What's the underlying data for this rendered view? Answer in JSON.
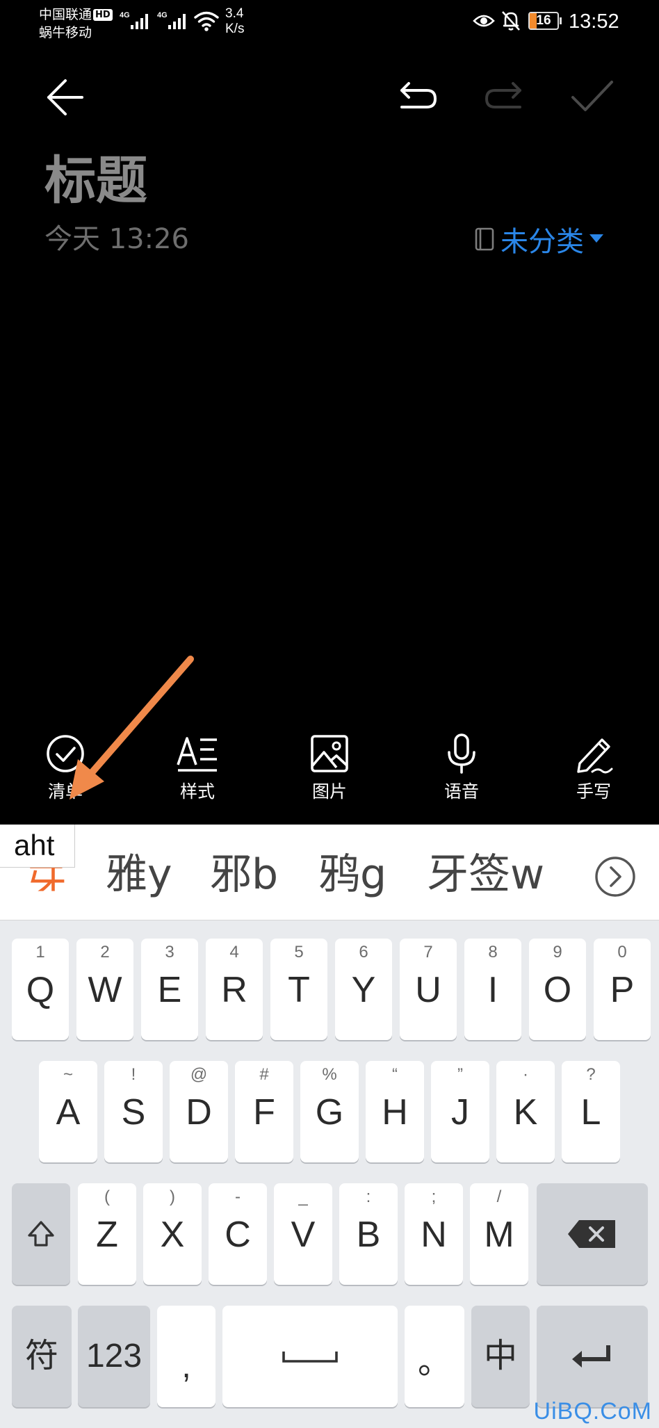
{
  "status_bar": {
    "carrier_primary": "中国联通",
    "hd_badge": "HD",
    "carrier_secondary": "蜗牛移动",
    "network_1": "4G",
    "network_2": "4G",
    "speed_value": "3.4",
    "speed_unit": "K/s",
    "battery_level": "16",
    "time": "13:52"
  },
  "toolbar": {
    "back_icon": "arrow-left-icon",
    "undo_icon": "undo-icon",
    "redo_icon": "redo-icon",
    "confirm_icon": "checkmark-icon"
  },
  "note": {
    "title_placeholder": "标题",
    "date": "今天 13:26",
    "category": "未分类"
  },
  "tools": [
    {
      "label": "清单",
      "icon": "checklist-icon"
    },
    {
      "label": "样式",
      "icon": "text-style-icon"
    },
    {
      "label": "图片",
      "icon": "image-icon"
    },
    {
      "label": "语音",
      "icon": "microphone-icon"
    },
    {
      "label": "手写",
      "icon": "pen-icon"
    }
  ],
  "candidates": {
    "pinyin": "aht",
    "items": [
      "牙",
      "雅y",
      "邪b",
      "鸦g",
      "牙签w"
    ]
  },
  "keyboard": {
    "row1": [
      {
        "num": "1",
        "key": "Q"
      },
      {
        "num": "2",
        "key": "W"
      },
      {
        "num": "3",
        "key": "E"
      },
      {
        "num": "4",
        "key": "R"
      },
      {
        "num": "5",
        "key": "T"
      },
      {
        "num": "6",
        "key": "Y"
      },
      {
        "num": "7",
        "key": "U"
      },
      {
        "num": "8",
        "key": "I"
      },
      {
        "num": "9",
        "key": "O"
      },
      {
        "num": "0",
        "key": "P"
      }
    ],
    "row2": [
      {
        "sym": "~",
        "key": "A"
      },
      {
        "sym": "!",
        "key": "S"
      },
      {
        "sym": "@",
        "key": "D"
      },
      {
        "sym": "#",
        "key": "F"
      },
      {
        "sym": "%",
        "key": "G"
      },
      {
        "sym": "“",
        "key": "H"
      },
      {
        "sym": "”",
        "key": "J"
      },
      {
        "sym": "·",
        "key": "K"
      },
      {
        "sym": "?",
        "key": "L"
      }
    ],
    "row3": [
      {
        "sym": "(",
        "key": "Z"
      },
      {
        "sym": ")",
        "key": "X"
      },
      {
        "sym": "-",
        "key": "C"
      },
      {
        "sym": "_",
        "key": "V"
      },
      {
        "sym": ":",
        "key": "B"
      },
      {
        "sym": ";",
        "key": "N"
      },
      {
        "sym": "/",
        "key": "M"
      }
    ],
    "symbols_key": "符",
    "numbers_key": "123",
    "comma_key": ",",
    "period_key": "。",
    "lang_key": "中"
  },
  "watermark": "UiBQ.CoM",
  "colors": {
    "accent": "#2a86e8",
    "annotation_arrow": "#f0894a",
    "candidate_highlight": "#f06a2c"
  }
}
